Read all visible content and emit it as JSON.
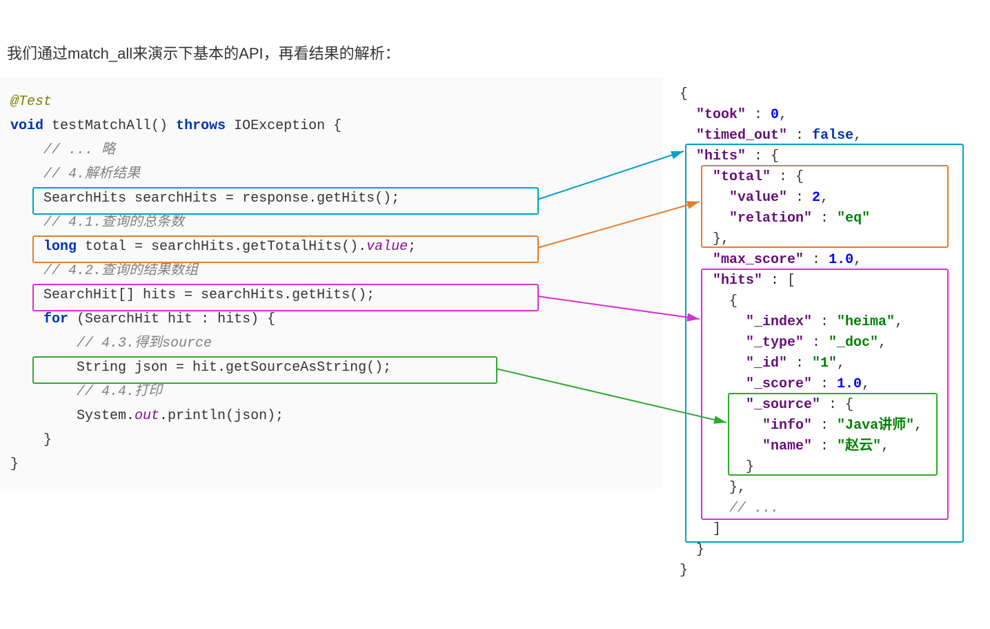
{
  "heading": "我们通过match_all来演示下基本的API，再看结果的解析：",
  "java": {
    "annotation": "@Test",
    "kw_void": "void",
    "fn_name": "testMatchAll()",
    "kw_throws": "throws",
    "exc": "IOException",
    "c_skip": "// ... 略",
    "c_4": "// 4.解析结果",
    "line_hits": "SearchHits searchHits = response.getHits();",
    "c_41": "// 4.1.查询的总条数",
    "kw_long": "long",
    "line_total_a": " total = searchHits.getTotalHits().",
    "fld_value": "value",
    "c_42": "// 4.2.查询的结果数组",
    "line_hits_arr": "SearchHit[] hits = searchHits.getHits();",
    "kw_for": "for",
    "line_for_rest": " (SearchHit hit : hits) {",
    "c_43": "// 4.3.得到source",
    "line_json": "String json = hit.getSourceAsString();",
    "c_44": "// 4.4.打印",
    "line_print_a": "System.",
    "fld_out": "out",
    "line_print_b": ".println(json);"
  },
  "json": {
    "took": "\"took\"",
    "took_v": "0",
    "timed_out": "\"timed_out\"",
    "timed_out_v": "false",
    "hits": "\"hits\"",
    "total": "\"total\"",
    "value": "\"value\"",
    "value_v": "2",
    "relation": "\"relation\"",
    "relation_v": "\"eq\"",
    "max_score": "\"max_score\"",
    "max_score_v": "1.0",
    "index": "\"_index\"",
    "index_v": "\"heima\"",
    "type": "\"_type\"",
    "type_v": "\"_doc\"",
    "id": "\"_id\"",
    "id_v": "\"1\"",
    "score": "\"_score\"",
    "score_v": "1.0",
    "source": "\"_source\"",
    "info": "\"info\"",
    "info_v": "\"Java讲师\"",
    "name": "\"name\"",
    "name_v": "\"赵云\"",
    "ellipsis": "// ..."
  },
  "chart_data": {
    "type": "table",
    "title": "Java RestHighLevelClient search result parsing mapped to Elasticsearch JSON response",
    "mappings": [
      {
        "java": "response.getHits()",
        "json_path": "hits",
        "color": "cyan"
      },
      {
        "java": "searchHits.getTotalHits().value",
        "json_path": "hits.total",
        "color": "orange"
      },
      {
        "java": "searchHits.getHits()",
        "json_path": "hits.hits",
        "color": "magenta"
      },
      {
        "java": "hit.getSourceAsString()",
        "json_path": "hits.hits[]._source",
        "color": "green"
      }
    ],
    "response_sample": {
      "took": 0,
      "timed_out": false,
      "hits": {
        "total": {
          "value": 2,
          "relation": "eq"
        },
        "max_score": 1.0,
        "hits": [
          {
            "_index": "heima",
            "_type": "_doc",
            "_id": "1",
            "_score": 1.0,
            "_source": {
              "info": "Java讲师",
              "name": "赵云"
            }
          }
        ]
      }
    }
  }
}
